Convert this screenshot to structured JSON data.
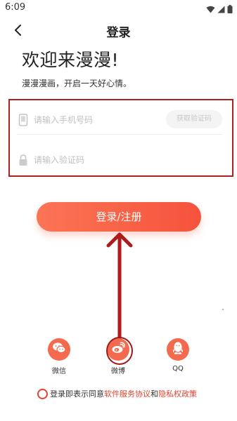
{
  "status_bar": {
    "time": "6:09"
  },
  "nav": {
    "title": "登录"
  },
  "welcome": {
    "title": "欢迎来漫漫!",
    "subtitle": "漫漫漫画，开启一天好心情。"
  },
  "form": {
    "phone_placeholder": "请输入手机号码",
    "get_code_label": "获取验证码",
    "code_placeholder": "请输入验证码"
  },
  "login_button": {
    "label": "登录/注册"
  },
  "social": [
    {
      "name": "微信",
      "icon": "wechat-icon"
    },
    {
      "name": "微博",
      "icon": "weibo-icon"
    },
    {
      "name": "QQ",
      "icon": "qq-icon"
    }
  ],
  "agreement": {
    "prefix": "登录即表示同意",
    "service_link": "软件服务协议",
    "connector": "和",
    "privacy_link": "隐私权政策"
  },
  "colors": {
    "accent": "#f6523c",
    "annotation": "#b02020",
    "link": "#e8402d"
  }
}
